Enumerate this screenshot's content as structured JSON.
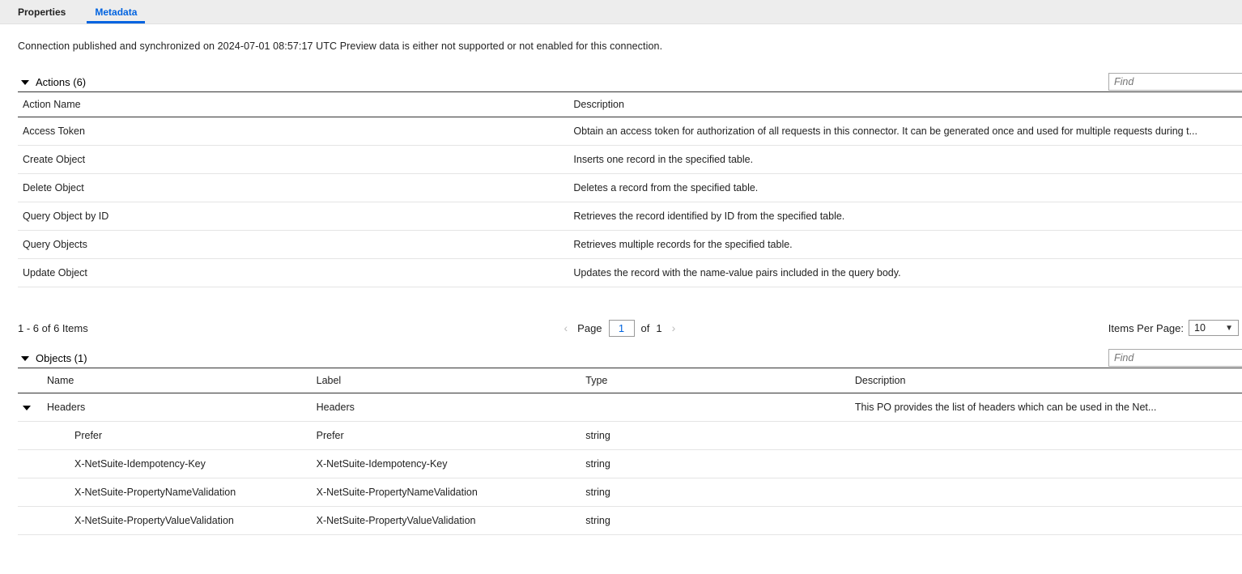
{
  "tabs": {
    "properties": "Properties",
    "metadata": "Metadata"
  },
  "status_text": "Connection published and synchronized on 2024-07-01 08:57:17 UTC Preview data is either not supported or not enabled for this connection.",
  "actions_section": {
    "title": "Actions (6)",
    "find_placeholder": "Find",
    "columns": {
      "name": "Action Name",
      "description": "Description"
    },
    "rows": [
      {
        "name": "Access Token",
        "description": "Obtain an access token for authorization of all requests in this connector. It can be generated once and used for multiple requests during t..."
      },
      {
        "name": "Create Object",
        "description": "Inserts one record in the specified table."
      },
      {
        "name": "Delete Object",
        "description": "Deletes a record from the specified table."
      },
      {
        "name": "Query Object by ID",
        "description": "Retrieves the record identified by ID from the specified table."
      },
      {
        "name": "Query Objects",
        "description": "Retrieves multiple records for the specified table."
      },
      {
        "name": "Update Object",
        "description": "Updates the record with the name-value pairs included in the query body."
      }
    ],
    "pager": {
      "summary": "1 - 6 of 6 Items",
      "page_label": "Page",
      "page_value": "1",
      "of_label": "of",
      "total_pages": "1",
      "ipp_label": "Items Per Page:",
      "ipp_value": "10"
    }
  },
  "objects_section": {
    "title": "Objects (1)",
    "find_placeholder": "Find",
    "columns": {
      "name": "Name",
      "label": "Label",
      "type": "Type",
      "description": "Description"
    },
    "parent_row": {
      "name": "Headers",
      "label": "Headers",
      "type": "",
      "description": "This PO provides the list of headers which can be used in the Net..."
    },
    "child_rows": [
      {
        "name": "Prefer",
        "label": "Prefer",
        "type": "string",
        "description": ""
      },
      {
        "name": "X-NetSuite-Idempotency-Key",
        "label": "X-NetSuite-Idempotency-Key",
        "type": "string",
        "description": ""
      },
      {
        "name": "X-NetSuite-PropertyNameValidation",
        "label": "X-NetSuite-PropertyNameValidation",
        "type": "string",
        "description": ""
      },
      {
        "name": "X-NetSuite-PropertyValueValidation",
        "label": "X-NetSuite-PropertyValueValidation",
        "type": "string",
        "description": ""
      }
    ]
  }
}
